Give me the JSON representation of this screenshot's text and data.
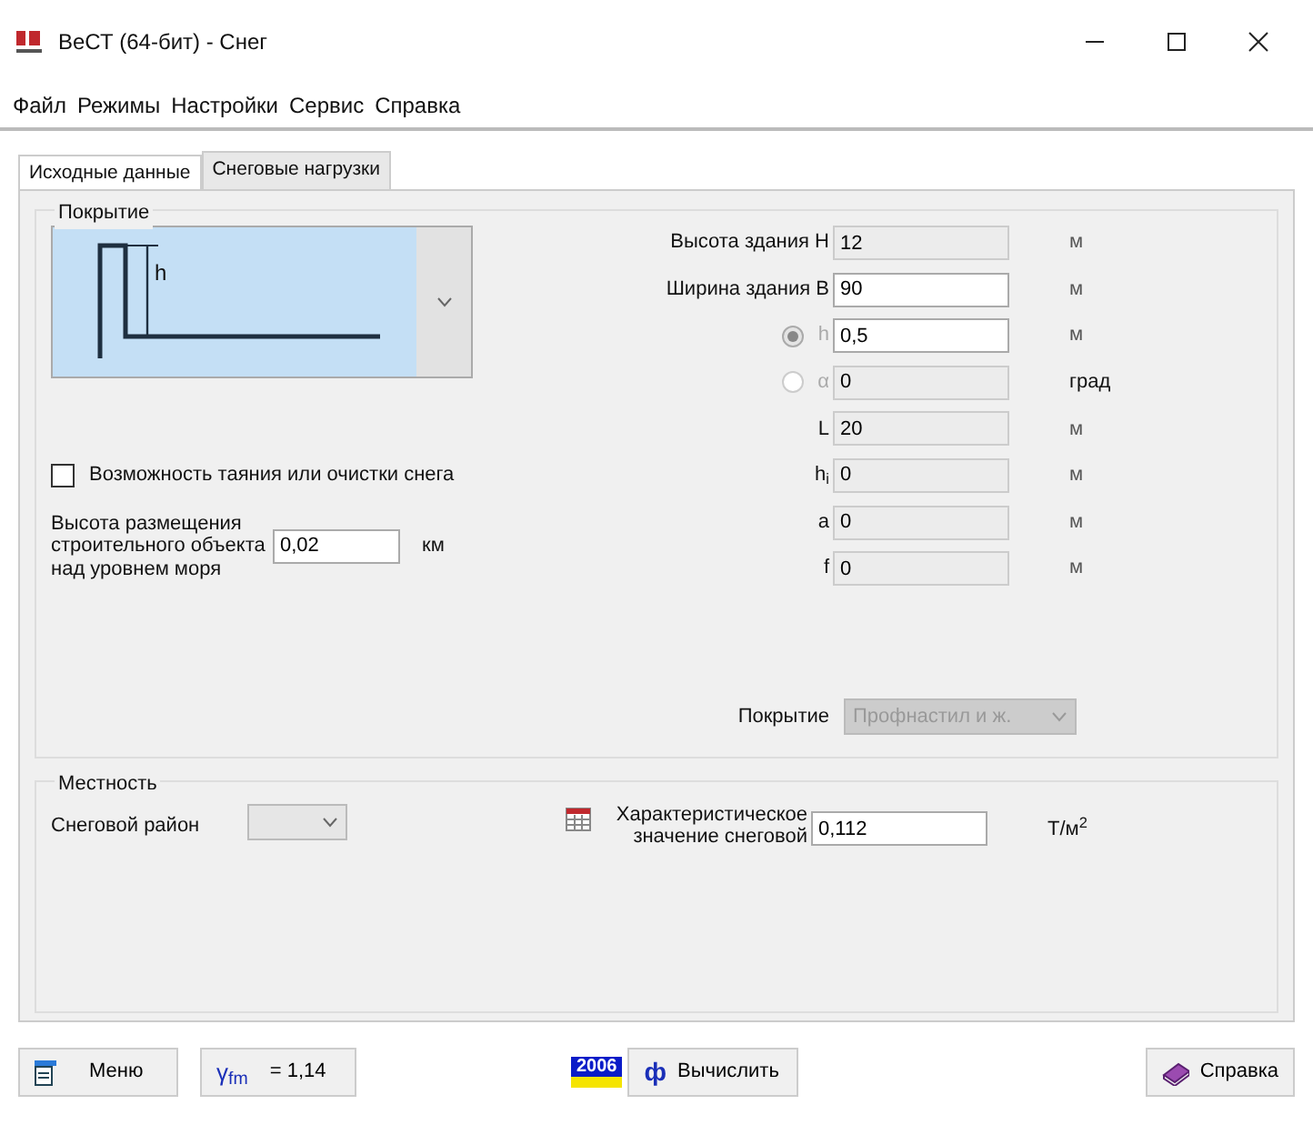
{
  "window": {
    "title": "ВеСТ (64-бит) - Снег"
  },
  "menu": [
    "Файл",
    "Режимы",
    "Настройки",
    "Сервис",
    "Справка"
  ],
  "tabs": [
    {
      "label": "Исходные данные",
      "selected": true
    },
    {
      "label": "Снеговые нагрузки",
      "selected": false
    }
  ],
  "roof": {
    "title": "Покрытие",
    "diagram_label": "h"
  },
  "snow_melt": {
    "label": "Возможность таяния или очистки снега",
    "checked": false
  },
  "altitude": {
    "label": "Высота размещения\nстроительного объекта\nнад уровнем моря",
    "value": "0,02",
    "unit": "км"
  },
  "params": [
    {
      "kind": "field",
      "label": "Высота здания H",
      "value": "12",
      "unit": "м",
      "editable": false
    },
    {
      "kind": "field",
      "label": "Ширина здания B",
      "value": "90",
      "unit": "м",
      "editable": true
    },
    {
      "kind": "radio",
      "label": "h",
      "value": "0,5",
      "unit": "м",
      "editable": true,
      "selected": true
    },
    {
      "kind": "radio",
      "label": "α",
      "value": "0",
      "unit": "град",
      "editable": false,
      "selected": false
    },
    {
      "kind": "field",
      "label": "L",
      "value": "20",
      "unit": "м",
      "editable": false
    },
    {
      "kind": "field",
      "label": "h$_{i}$",
      "value": "0",
      "unit": "м",
      "editable": false
    },
    {
      "kind": "field",
      "label": "a",
      "value": "0",
      "unit": "м",
      "editable": false
    },
    {
      "kind": "field",
      "label": "f",
      "value": "0",
      "unit": "м",
      "editable": false
    }
  ],
  "cover": {
    "label": "Покрытие",
    "value": "Профнастил и ж.",
    "disabled": true
  },
  "terrain": {
    "title": "Местность",
    "district_label": "Снеговой район",
    "char_label": "Характеристическое\nзначение снеговой",
    "char_value": "0,112",
    "char_unit": "Т/м$^{2}$"
  },
  "footer": {
    "menu_button": "Меню",
    "gamma_symbol": "γ$_{fm}$",
    "gamma_value": "= 1,14",
    "year_badge": "2006",
    "calc_symbol": "ф",
    "calc_button": "Вычислить",
    "help_button": "Справка"
  }
}
